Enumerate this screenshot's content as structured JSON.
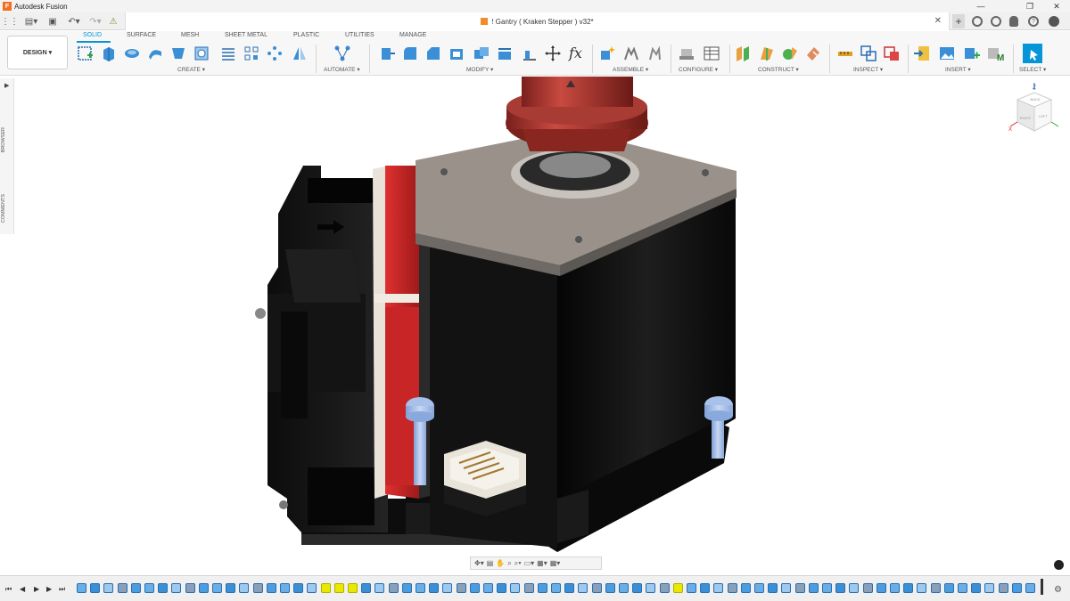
{
  "app": {
    "title": "Autodesk Fusion"
  },
  "document": {
    "tab_title": "! Gantry ( Kraken Stepper ) v32*"
  },
  "workspace": {
    "label": "DESIGN ▾"
  },
  "ribbon": {
    "tabs": [
      {
        "label": "SOLID",
        "active": true
      },
      {
        "label": "SURFACE"
      },
      {
        "label": "MESH"
      },
      {
        "label": "SHEET METAL"
      },
      {
        "label": "PLASTIC"
      },
      {
        "label": "UTILITIES"
      },
      {
        "label": "MANAGE"
      }
    ],
    "groups": {
      "create": "CREATE ▾",
      "automate": "AUTOMATE ▾",
      "modify": "MODIFY ▾",
      "assemble": "ASSEMBLE ▾",
      "configure": "CONFIGURE ▾",
      "construct": "CONSTRUCT ▾",
      "inspect": "INSPECT ▾",
      "insert": "INSERT ▾",
      "select": "SELECT ▾"
    },
    "fx_label": "fx"
  },
  "browser": {
    "label": "BROWSER",
    "comments_label": "COMMENTS"
  },
  "viewcube": {
    "top": "Z",
    "front": "X",
    "back": "BACK",
    "right": "RIGHT",
    "left": "LEFT"
  },
  "colors": {
    "accent": "#0696d7",
    "motor_body": "#111111",
    "mount_plate": "#9a928a",
    "pulley": "#b53a32",
    "fan_shroud_red": "#d42a28",
    "bolt": "#9bb9e6",
    "timeline_highlight": "#e8e800"
  },
  "icons": {
    "titlebar": [
      "fusion-logo-icon",
      "minimize-icon",
      "maximize-icon",
      "close-icon"
    ],
    "nav": [
      "orbit-icon",
      "pan-icon",
      "look-icon",
      "zoom-icon",
      "display-settings-icon",
      "visual-style-icon",
      "grid-icon"
    ]
  }
}
